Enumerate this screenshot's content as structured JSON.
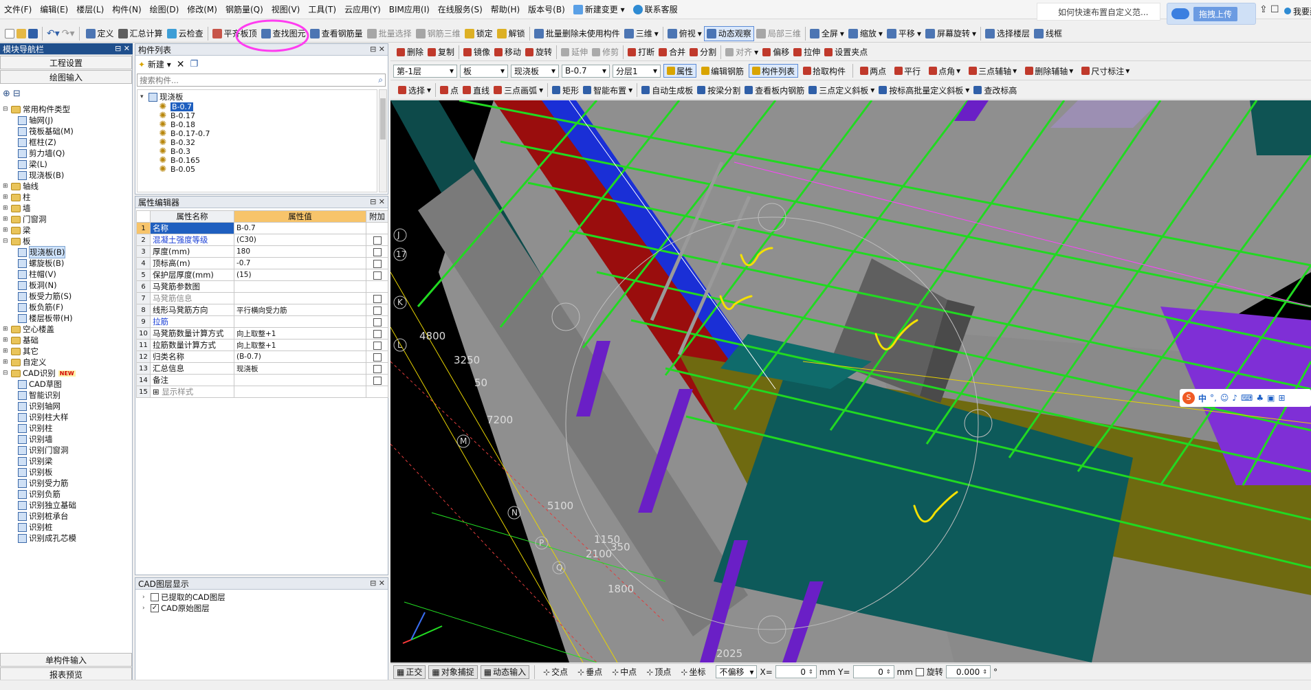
{
  "menu": [
    "文件(F)",
    "编辑(E)",
    "楼层(L)",
    "构件(N)",
    "绘图(D)",
    "修改(M)",
    "钢筋量(Q)",
    "视图(V)",
    "工具(T)",
    "云应用(Y)",
    "BIM应用(I)",
    "在线服务(S)",
    "帮助(H)",
    "版本号(B)"
  ],
  "menu_extra": {
    "new_change": "新建变更",
    "contact": "联系客服"
  },
  "question": "如何快速布置自定义范...",
  "upload": "拖拽上传",
  "right_cut": "我要建",
  "toolbar1": [
    "定义",
    "汇总计算",
    "云检查",
    "平齐板顶",
    "查找图元",
    "查看钢筋量",
    "批量选择",
    "钢筋三维",
    "锁定",
    "解锁",
    "批量删除未使用构件",
    "三维",
    "俯视",
    "动态观察",
    "局部三维",
    "全屏",
    "缩放",
    "平移",
    "屏幕旋转",
    "选择楼层",
    "线框"
  ],
  "toolbar2": [
    "删除",
    "复制",
    "镜像",
    "移动",
    "旋转",
    "延伸",
    "修剪",
    "打断",
    "合并",
    "分割",
    "对齐",
    "偏移",
    "拉伸",
    "设置夹点"
  ],
  "toolbar3": {
    "floor": "第-1层",
    "type": "板",
    "subtype": "现浇板",
    "comp": "B-0.7",
    "layer": "分层1",
    "buttons": [
      "属性",
      "编辑钢筋",
      "构件列表",
      "拾取构件",
      "两点",
      "平行",
      "点角",
      "三点辅轴",
      "删除辅轴",
      "尺寸标注"
    ]
  },
  "toolbar4": [
    "选择",
    "点",
    "直线",
    "三点画弧",
    "矩形",
    "智能布置",
    "自动生成板",
    "按梁分割",
    "查看板内钢筋",
    "三点定义斜板",
    "按标高批量定义斜板",
    "查改标高"
  ],
  "nav": {
    "title": "模块导航栏",
    "btn1": "工程设置",
    "btn2": "绘图输入",
    "tree": [
      {
        "t": "常用构件类型",
        "lvl": 0,
        "kind": "folder",
        "open": true
      },
      {
        "t": "轴网(J)",
        "lvl": 1,
        "kind": "grid"
      },
      {
        "t": "筏板基础(M)",
        "lvl": 1,
        "kind": "grid"
      },
      {
        "t": "框柱(Z)",
        "lvl": 1,
        "kind": "grid"
      },
      {
        "t": "剪力墙(Q)",
        "lvl": 1,
        "kind": "grid"
      },
      {
        "t": "梁(L)",
        "lvl": 1,
        "kind": "grid"
      },
      {
        "t": "现浇板(B)",
        "lvl": 1,
        "kind": "grid"
      },
      {
        "t": "轴线",
        "lvl": 0,
        "kind": "folder"
      },
      {
        "t": "柱",
        "lvl": 0,
        "kind": "folder"
      },
      {
        "t": "墙",
        "lvl": 0,
        "kind": "folder"
      },
      {
        "t": "门窗洞",
        "lvl": 0,
        "kind": "folder"
      },
      {
        "t": "梁",
        "lvl": 0,
        "kind": "folder"
      },
      {
        "t": "板",
        "lvl": 0,
        "kind": "folder",
        "open": true
      },
      {
        "t": "现浇板(B)",
        "lvl": 1,
        "kind": "grid",
        "sel": true
      },
      {
        "t": "螺旋板(B)",
        "lvl": 1,
        "kind": "grid"
      },
      {
        "t": "柱帽(V)",
        "lvl": 1,
        "kind": "grid"
      },
      {
        "t": "板洞(N)",
        "lvl": 1,
        "kind": "grid"
      },
      {
        "t": "板受力筋(S)",
        "lvl": 1,
        "kind": "grid"
      },
      {
        "t": "板负筋(F)",
        "lvl": 1,
        "kind": "grid"
      },
      {
        "t": "楼层板带(H)",
        "lvl": 1,
        "kind": "grid"
      },
      {
        "t": "空心楼盖",
        "lvl": 0,
        "kind": "folder"
      },
      {
        "t": "基础",
        "lvl": 0,
        "kind": "folder"
      },
      {
        "t": "其它",
        "lvl": 0,
        "kind": "folder"
      },
      {
        "t": "自定义",
        "lvl": 0,
        "kind": "folder"
      },
      {
        "t": "CAD识别",
        "lvl": 0,
        "kind": "folder",
        "open": true,
        "badge": "NEW"
      },
      {
        "t": "CAD草图",
        "lvl": 1,
        "kind": "grid"
      },
      {
        "t": "智能识别",
        "lvl": 1,
        "kind": "grid"
      },
      {
        "t": "识别轴网",
        "lvl": 1,
        "kind": "grid"
      },
      {
        "t": "识别柱大样",
        "lvl": 1,
        "kind": "grid"
      },
      {
        "t": "识别柱",
        "lvl": 1,
        "kind": "grid"
      },
      {
        "t": "识别墙",
        "lvl": 1,
        "kind": "grid"
      },
      {
        "t": "识别门窗洞",
        "lvl": 1,
        "kind": "grid"
      },
      {
        "t": "识别梁",
        "lvl": 1,
        "kind": "grid"
      },
      {
        "t": "识别板",
        "lvl": 1,
        "kind": "grid"
      },
      {
        "t": "识别受力筋",
        "lvl": 1,
        "kind": "grid"
      },
      {
        "t": "识别负筋",
        "lvl": 1,
        "kind": "grid"
      },
      {
        "t": "识别独立基础",
        "lvl": 1,
        "kind": "grid"
      },
      {
        "t": "识别桩承台",
        "lvl": 1,
        "kind": "grid"
      },
      {
        "t": "识别桩",
        "lvl": 1,
        "kind": "grid"
      },
      {
        "t": "识别成孔芯模",
        "lvl": 1,
        "kind": "grid"
      }
    ],
    "bottom1": "单构件输入",
    "bottom2": "报表预览"
  },
  "complist": {
    "title": "构件列表",
    "new": "新建",
    "search_placeholder": "搜索构件...",
    "root": "现浇板",
    "items": [
      "B-0.7",
      "B-0.17",
      "B-0.18",
      "B-0.17-0.7",
      "B-0.32",
      "B-0.3",
      "B-0.165",
      "B-0.05"
    ]
  },
  "props": {
    "title": "属性编辑器",
    "headers": [
      "属性名称",
      "属性值",
      "附加"
    ],
    "rows": [
      {
        "n": "1",
        "name": "名称",
        "val": "B-0.7",
        "chk": false,
        "blue": true,
        "sel": true
      },
      {
        "n": "2",
        "name": "混凝土强度等级",
        "val": "(C30)",
        "chk": true,
        "blue": true
      },
      {
        "n": "3",
        "name": "厚度(mm)",
        "val": "180",
        "chk": true
      },
      {
        "n": "4",
        "name": "顶标高(m)",
        "val": "-0.7",
        "chk": true
      },
      {
        "n": "5",
        "name": "保护层厚度(mm)",
        "val": "(15)",
        "chk": true
      },
      {
        "n": "6",
        "name": "马凳筋参数图",
        "val": "",
        "chk": false
      },
      {
        "n": "7",
        "name": "马凳筋信息",
        "val": "",
        "chk": true,
        "gray": true
      },
      {
        "n": "8",
        "name": "线形马凳筋方向",
        "val": "平行横向受力筋",
        "chk": true
      },
      {
        "n": "9",
        "name": "拉筋",
        "val": "",
        "chk": true,
        "blue": true
      },
      {
        "n": "10",
        "name": "马凳筋数量计算方式",
        "val": "向上取整+1",
        "chk": true
      },
      {
        "n": "11",
        "name": "拉筋数量计算方式",
        "val": "向上取整+1",
        "chk": true
      },
      {
        "n": "12",
        "name": "归类名称",
        "val": "(B-0.7)",
        "chk": true
      },
      {
        "n": "13",
        "name": "汇总信息",
        "val": "现浇板",
        "chk": true
      },
      {
        "n": "14",
        "name": "备注",
        "val": "",
        "chk": true
      },
      {
        "n": "15",
        "name": "显示样式",
        "val": "",
        "chk": false,
        "gray": true,
        "plus": true
      }
    ]
  },
  "cad": {
    "title": "CAD图层显示",
    "items": [
      "已提取的CAD图层",
      "CAD原始图层"
    ]
  },
  "canvas_labels": {
    "axes": [
      "J",
      "17",
      "K",
      "L",
      "M",
      "N",
      "P",
      "Q"
    ],
    "dims": [
      "4800",
      "3250",
      "50",
      "7200",
      "5100",
      "1150",
      "350",
      "2100",
      "1800",
      "2025"
    ]
  },
  "status": {
    "items": [
      "正交",
      "对象捕捉",
      "动态输入",
      "交点",
      "垂点",
      "中点",
      "顶点",
      "坐标"
    ],
    "offset": "不偏移",
    "x_label": "X=",
    "y_label": "Y=",
    "x": "0",
    "y": "0",
    "unit": "mm",
    "rotate_label": "旋转",
    "rotate": "0.000",
    "deg": "°"
  },
  "ime": {
    "text": "中"
  },
  "colors": {
    "accent": "#3a6ea5",
    "highlight": "#ff3df0",
    "annot": "#f4e000"
  }
}
